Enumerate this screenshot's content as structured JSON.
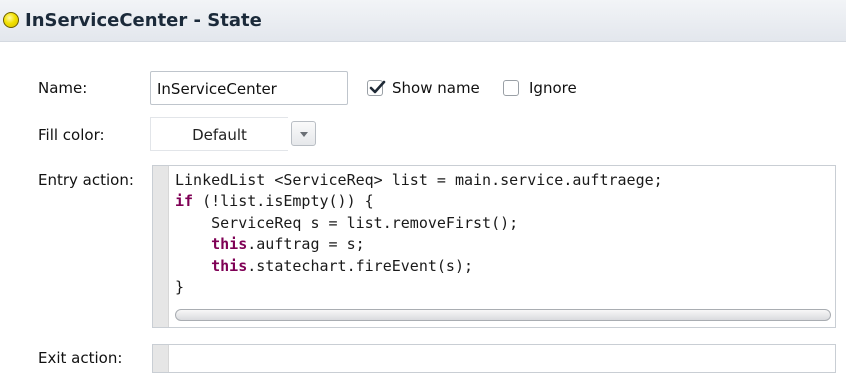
{
  "header": {
    "title": "InServiceCenter - State",
    "icon": "state-oval-icon",
    "icon_color": "#f2e100"
  },
  "form": {
    "name_label": "Name:",
    "name_value": "InServiceCenter",
    "show_name_label": "Show name",
    "show_name_checked": true,
    "ignore_label": "Ignore",
    "ignore_checked": false,
    "fill_color_label": "Fill color:",
    "fill_color_value": "Default",
    "entry_action_label": "Entry action:",
    "exit_action_label": "Exit action:",
    "exit_action_value": ""
  },
  "entry_code": {
    "line1": "LinkedList <ServiceReq> list = main.service.auftraege;",
    "line2_kw": "if",
    "line2_rest": " (!list.isEmpty()) {",
    "line3": "    ServiceReq s = list.removeFirst();",
    "line4_indent": "    ",
    "line4_kw": "this",
    "line4_rest": ".auftrag = s;",
    "line5_indent": "    ",
    "line5_kw": "this",
    "line5_rest": ".statechart.fireEvent(s);",
    "line6": "}"
  },
  "colors": {
    "keyword": "#7f0055",
    "header_bg": "#e9ecf0",
    "gutter": "#e6e6e6"
  }
}
